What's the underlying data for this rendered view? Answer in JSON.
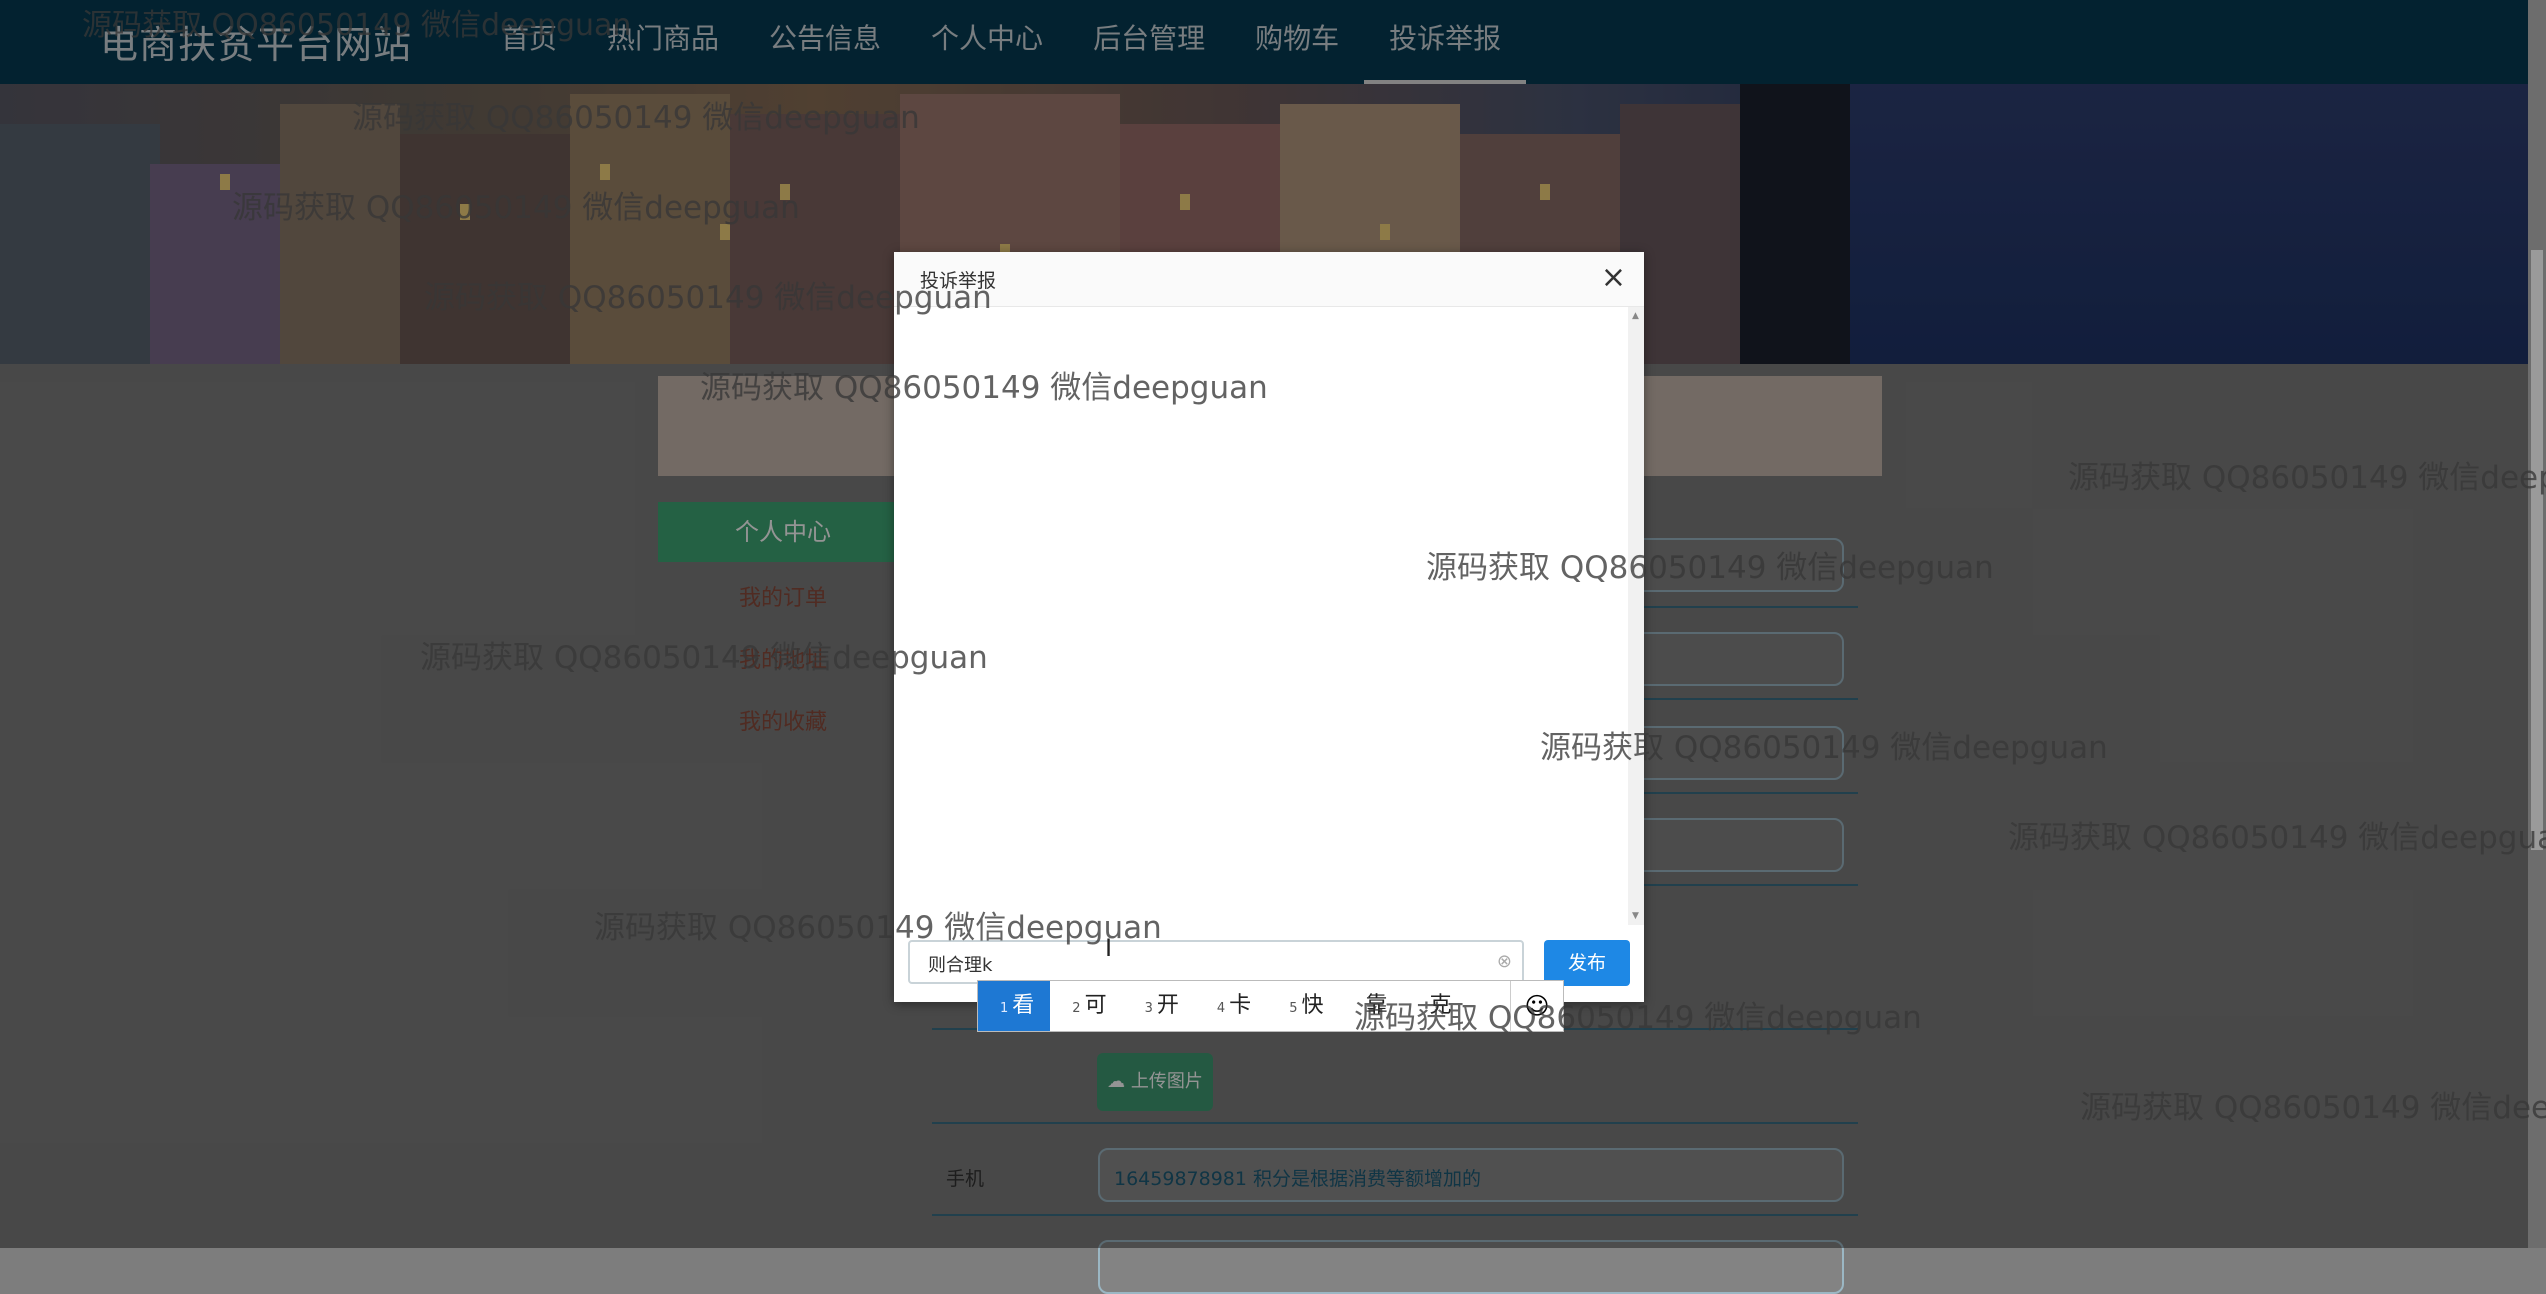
{
  "navbar": {
    "brand": "电商扶贫平台网站",
    "items": [
      {
        "label": "首页"
      },
      {
        "label": "热门商品"
      },
      {
        "label": "公告信息"
      },
      {
        "label": "个人中心"
      },
      {
        "label": "后台管理"
      },
      {
        "label": "购物车"
      },
      {
        "label": "投诉举报",
        "active": true
      }
    ]
  },
  "sidebar": {
    "active": "个人中心",
    "links": [
      "我的订单",
      "我的地址",
      "我的收藏"
    ]
  },
  "form": {
    "upload_label": "上传图片",
    "phone_label": "手机",
    "phone_value": "16459878981 积分是根据消费等额增加的"
  },
  "dialog": {
    "title": "投诉举报",
    "close": "×",
    "input_value": "则合理k",
    "publish": "发布"
  },
  "ime": {
    "candidates": [
      {
        "num": "1",
        "text": "看",
        "selected": true
      },
      {
        "num": "2",
        "text": "可"
      },
      {
        "num": "3",
        "text": "开"
      },
      {
        "num": "4",
        "text": "卡"
      },
      {
        "num": "5",
        "text": "快"
      },
      {
        "num": "",
        "text": "靠"
      },
      {
        "num": "",
        "text": "克"
      }
    ],
    "emoji": "☺"
  },
  "watermark": "源码获取 QQ86050149 微信deepguan"
}
